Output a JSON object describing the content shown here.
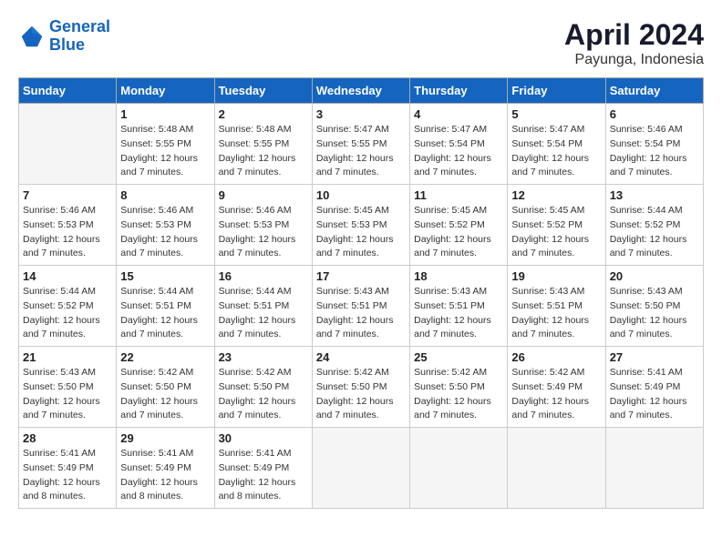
{
  "header": {
    "logo_line1": "General",
    "logo_line2": "Blue",
    "title": "April 2024",
    "subtitle": "Payunga, Indonesia"
  },
  "days": [
    "Sunday",
    "Monday",
    "Tuesday",
    "Wednesday",
    "Thursday",
    "Friday",
    "Saturday"
  ],
  "weeks": [
    [
      {
        "date": "",
        "info": ""
      },
      {
        "date": "1",
        "info": "Sunrise: 5:48 AM\nSunset: 5:55 PM\nDaylight: 12 hours\nand 7 minutes."
      },
      {
        "date": "2",
        "info": "Sunrise: 5:48 AM\nSunset: 5:55 PM\nDaylight: 12 hours\nand 7 minutes."
      },
      {
        "date": "3",
        "info": "Sunrise: 5:47 AM\nSunset: 5:55 PM\nDaylight: 12 hours\nand 7 minutes."
      },
      {
        "date": "4",
        "info": "Sunrise: 5:47 AM\nSunset: 5:54 PM\nDaylight: 12 hours\nand 7 minutes."
      },
      {
        "date": "5",
        "info": "Sunrise: 5:47 AM\nSunset: 5:54 PM\nDaylight: 12 hours\nand 7 minutes."
      },
      {
        "date": "6",
        "info": "Sunrise: 5:46 AM\nSunset: 5:54 PM\nDaylight: 12 hours\nand 7 minutes."
      }
    ],
    [
      {
        "date": "7",
        "info": "Sunrise: 5:46 AM\nSunset: 5:53 PM\nDaylight: 12 hours\nand 7 minutes."
      },
      {
        "date": "8",
        "info": "Sunrise: 5:46 AM\nSunset: 5:53 PM\nDaylight: 12 hours\nand 7 minutes."
      },
      {
        "date": "9",
        "info": "Sunrise: 5:46 AM\nSunset: 5:53 PM\nDaylight: 12 hours\nand 7 minutes."
      },
      {
        "date": "10",
        "info": "Sunrise: 5:45 AM\nSunset: 5:53 PM\nDaylight: 12 hours\nand 7 minutes."
      },
      {
        "date": "11",
        "info": "Sunrise: 5:45 AM\nSunset: 5:52 PM\nDaylight: 12 hours\nand 7 minutes."
      },
      {
        "date": "12",
        "info": "Sunrise: 5:45 AM\nSunset: 5:52 PM\nDaylight: 12 hours\nand 7 minutes."
      },
      {
        "date": "13",
        "info": "Sunrise: 5:44 AM\nSunset: 5:52 PM\nDaylight: 12 hours\nand 7 minutes."
      }
    ],
    [
      {
        "date": "14",
        "info": "Sunrise: 5:44 AM\nSunset: 5:52 PM\nDaylight: 12 hours\nand 7 minutes."
      },
      {
        "date": "15",
        "info": "Sunrise: 5:44 AM\nSunset: 5:51 PM\nDaylight: 12 hours\nand 7 minutes."
      },
      {
        "date": "16",
        "info": "Sunrise: 5:44 AM\nSunset: 5:51 PM\nDaylight: 12 hours\nand 7 minutes."
      },
      {
        "date": "17",
        "info": "Sunrise: 5:43 AM\nSunset: 5:51 PM\nDaylight: 12 hours\nand 7 minutes."
      },
      {
        "date": "18",
        "info": "Sunrise: 5:43 AM\nSunset: 5:51 PM\nDaylight: 12 hours\nand 7 minutes."
      },
      {
        "date": "19",
        "info": "Sunrise: 5:43 AM\nSunset: 5:51 PM\nDaylight: 12 hours\nand 7 minutes."
      },
      {
        "date": "20",
        "info": "Sunrise: 5:43 AM\nSunset: 5:50 PM\nDaylight: 12 hours\nand 7 minutes."
      }
    ],
    [
      {
        "date": "21",
        "info": "Sunrise: 5:43 AM\nSunset: 5:50 PM\nDaylight: 12 hours\nand 7 minutes."
      },
      {
        "date": "22",
        "info": "Sunrise: 5:42 AM\nSunset: 5:50 PM\nDaylight: 12 hours\nand 7 minutes."
      },
      {
        "date": "23",
        "info": "Sunrise: 5:42 AM\nSunset: 5:50 PM\nDaylight: 12 hours\nand 7 minutes."
      },
      {
        "date": "24",
        "info": "Sunrise: 5:42 AM\nSunset: 5:50 PM\nDaylight: 12 hours\nand 7 minutes."
      },
      {
        "date": "25",
        "info": "Sunrise: 5:42 AM\nSunset: 5:50 PM\nDaylight: 12 hours\nand 7 minutes."
      },
      {
        "date": "26",
        "info": "Sunrise: 5:42 AM\nSunset: 5:49 PM\nDaylight: 12 hours\nand 7 minutes."
      },
      {
        "date": "27",
        "info": "Sunrise: 5:41 AM\nSunset: 5:49 PM\nDaylight: 12 hours\nand 7 minutes."
      }
    ],
    [
      {
        "date": "28",
        "info": "Sunrise: 5:41 AM\nSunset: 5:49 PM\nDaylight: 12 hours\nand 8 minutes."
      },
      {
        "date": "29",
        "info": "Sunrise: 5:41 AM\nSunset: 5:49 PM\nDaylight: 12 hours\nand 8 minutes."
      },
      {
        "date": "30",
        "info": "Sunrise: 5:41 AM\nSunset: 5:49 PM\nDaylight: 12 hours\nand 8 minutes."
      },
      {
        "date": "",
        "info": ""
      },
      {
        "date": "",
        "info": ""
      },
      {
        "date": "",
        "info": ""
      },
      {
        "date": "",
        "info": ""
      }
    ]
  ]
}
